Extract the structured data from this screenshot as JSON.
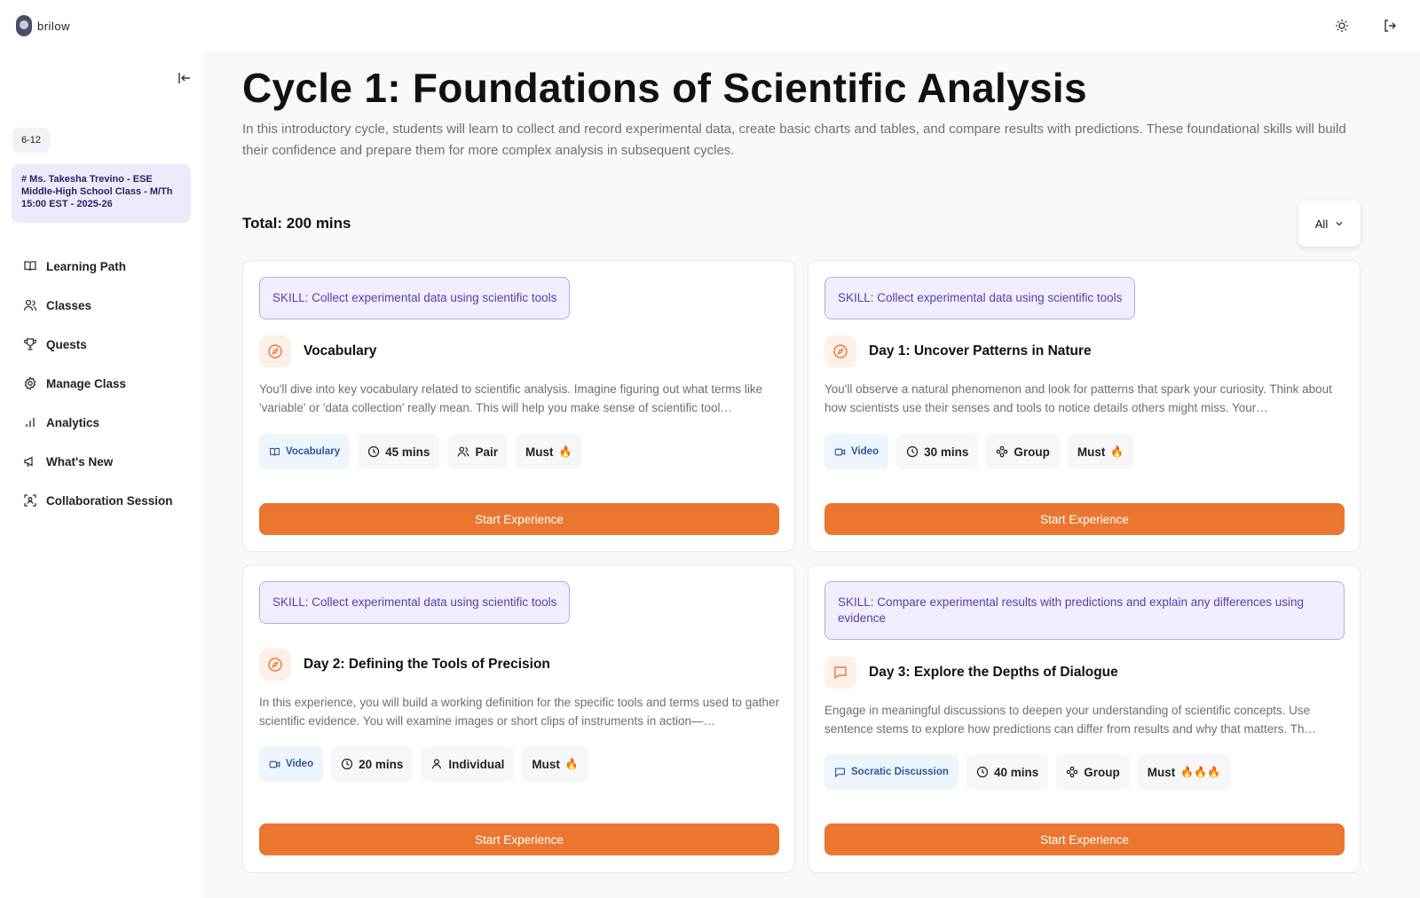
{
  "app": {
    "name": "brilow"
  },
  "sidebar": {
    "grade": "6-12",
    "class_name": "# Ms. Takesha Trevino - ESE Middle-High School Class - M/Th 15:00 EST - 2025-26",
    "items": [
      {
        "label": "Learning Path",
        "icon": "book-icon"
      },
      {
        "label": "Classes",
        "icon": "users-icon"
      },
      {
        "label": "Quests",
        "icon": "trophy-icon"
      },
      {
        "label": "Manage Class",
        "icon": "gear-icon"
      },
      {
        "label": "Analytics",
        "icon": "bar-chart-icon"
      },
      {
        "label": "What's New",
        "icon": "megaphone-icon"
      },
      {
        "label": "Collaboration Session",
        "icon": "scan-user-icon"
      }
    ]
  },
  "main": {
    "title": "Cycle 1: Foundations of Scientific Analysis",
    "description": "In this introductory cycle, students will learn to collect and record experimental data, create basic charts and tables, and compare results with predictions. These foundational skills will build their confidence and prepare them for more complex analysis in subsequent cycles.",
    "total": "Total: 200 mins",
    "filter": "All",
    "cards": [
      {
        "skill": "SKILL: Collect experimental data using scientific tools",
        "title": "Vocabulary",
        "description": "You'll dive into key vocabulary related to scientific analysis. Imagine figuring out what terms like 'variable' or 'data collection' really mean. This will help you make sense of scientific tool…",
        "type": "Vocabulary",
        "duration": "45 mins",
        "grouping": "Pair",
        "priority": "Must",
        "flames": "🔥",
        "button": "Start Experience"
      },
      {
        "skill": "SKILL: Collect experimental data using scientific tools",
        "title": "Day 1: Uncover Patterns in Nature",
        "description": "You'll observe a natural phenomenon and look for patterns that spark your curiosity. Think about how scientists use their senses and tools to notice details others might miss. Your…",
        "type": "Video",
        "duration": "30 mins",
        "grouping": "Group",
        "priority": "Must",
        "flames": "🔥",
        "button": "Start Experience"
      },
      {
        "skill": "SKILL: Collect experimental data using scientific tools",
        "title": "Day 2: Defining the Tools of Precision",
        "description": "In this experience, you will build a working definition for the specific tools and terms used to gather scientific evidence. You will examine images or short clips of instruments in action—…",
        "type": "Video",
        "duration": "20 mins",
        "grouping": "Individual",
        "priority": "Must",
        "flames": "🔥",
        "button": "Start Experience"
      },
      {
        "skill": "SKILL: Compare experimental results with predictions and explain any differences using evidence",
        "title": "Day 3: Explore the Depths of Dialogue",
        "description": "Engage in meaningful discussions to deepen your understanding of scientific concepts. Use sentence stems to explore how predictions can differ from results and why that matters. Th…",
        "type": "Socratic Discussion",
        "duration": "40 mins",
        "grouping": "Group",
        "priority": "Must",
        "flames": "🔥🔥🔥",
        "button": "Start Experience"
      }
    ]
  },
  "colors": {
    "accent": "#ea7630",
    "skill_border": "#b9a6ee",
    "skill_bg": "#f3eefd",
    "class_bg": "#efe9fb"
  }
}
